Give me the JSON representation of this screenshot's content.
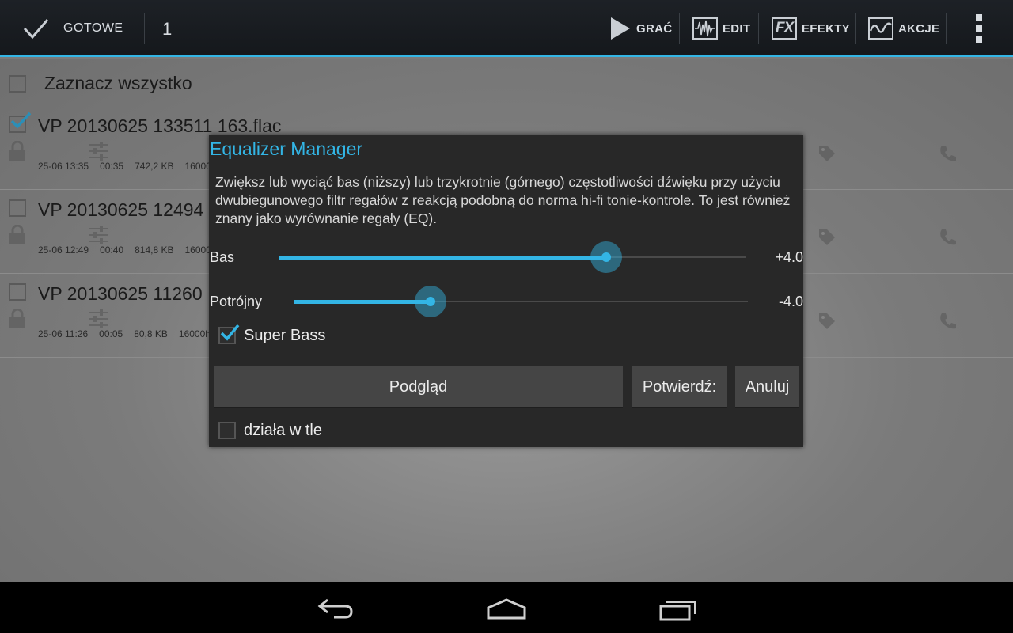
{
  "actionbar": {
    "done_label": "GOTOWE",
    "selected_count": "1",
    "play_label": "GRAĆ",
    "edit_label": "EDIT",
    "effects_label": "EFEKTY",
    "actions_label": "AKCJE",
    "fx_glyph": "FX"
  },
  "list": {
    "select_all_label": "Zaznacz wszystko",
    "rows": [
      {
        "title": "VP 20130625 133511 163.flac",
        "date": "25-06 13:35",
        "duration": "00:35",
        "size": "742,2 KB",
        "rate": "16000",
        "checked": true
      },
      {
        "title": "VP 20130625 12494",
        "date": "25-06 12:49",
        "duration": "00:40",
        "size": "814,8 KB",
        "rate": "16000",
        "checked": false
      },
      {
        "title": "VP 20130625 11260",
        "date": "25-06 11:26",
        "duration": "00:05",
        "size": "80,8 KB",
        "rate": "16000h",
        "checked": false
      }
    ]
  },
  "dialog": {
    "title": "Equalizer Manager",
    "description": "Zwiększ lub wyciąć bas (niższy) lub trzykrotnie (górnego) częstotliwości dźwięku przy użyciu dwubiegunowego filtr regałów z reakcją podobną do norma hi-fi tonie-kontrole. To jest również znany jako wyrównanie regały (EQ).",
    "bass": {
      "label": "Bas",
      "value_text": "+4.0",
      "level": 0.7
    },
    "treble": {
      "label": "Potrójny",
      "value_text": "-4.0",
      "level": 0.3
    },
    "super_bass": {
      "label": "Super Bass",
      "checked": true
    },
    "preview_label": "Podgląd",
    "confirm_label": "Potwierdź:",
    "cancel_label": "Anuluj",
    "background_label": "działa w tle",
    "background_checked": false
  },
  "colors": {
    "accent": "#33b5e5",
    "dialog_bg": "#282828",
    "actionbar_bg": "#1b1e22"
  },
  "navbar": {
    "icons": [
      "back-icon",
      "home-icon",
      "recent-apps-icon"
    ]
  }
}
